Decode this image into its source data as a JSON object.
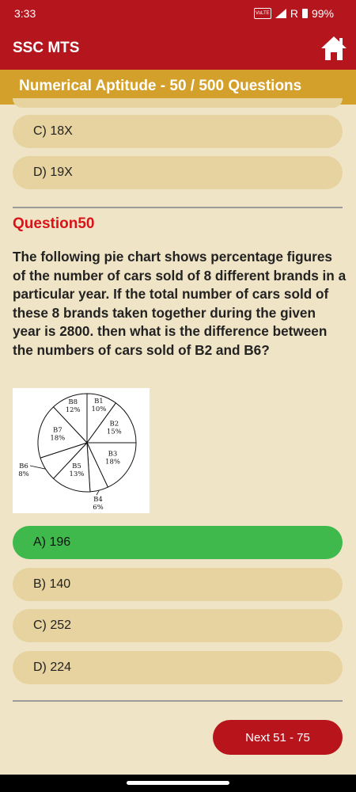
{
  "status_bar": {
    "time": "3:33",
    "volte": "VoLTE",
    "signal": "R",
    "battery": "99%"
  },
  "app_bar": {
    "title": "SSC MTS"
  },
  "sub_header": {
    "title": "Numerical Aptitude - 50 / 500 Questions"
  },
  "previous_question": {
    "options": [
      {
        "label": "C) 18X"
      },
      {
        "label": "D) 19X"
      }
    ]
  },
  "question": {
    "number": "Question50",
    "text": "The following pie chart shows percentage figures of the number of cars sold of 8 different brands in a particular year. If the total number of cars sold of these 8 brands taken together during the given year is 2800. then what is the difference between the numbers of cars sold of B2 and B6?",
    "options": [
      {
        "label": "A) 196",
        "correct": true
      },
      {
        "label": "B) 140",
        "correct": false
      },
      {
        "label": "C) 252",
        "correct": false
      },
      {
        "label": "D) 224",
        "correct": false
      }
    ]
  },
  "chart_data": {
    "type": "pie",
    "title": "",
    "categories": [
      "B1",
      "B2",
      "B3",
      "B4",
      "B5",
      "B6",
      "B7",
      "B8"
    ],
    "values": [
      10,
      15,
      18,
      6,
      13,
      8,
      18,
      12
    ],
    "labels": [
      "10%",
      "15%",
      "18%",
      "6%",
      "13%",
      "8%",
      "18%",
      "12%"
    ]
  },
  "footer": {
    "next_label": "Next 51 - 75"
  },
  "colors": {
    "primary": "#b5161e",
    "accent": "#d4a02c",
    "option_bg": "#e7d3a0",
    "correct": "#3fb94c",
    "background": "#f0e4c6"
  }
}
